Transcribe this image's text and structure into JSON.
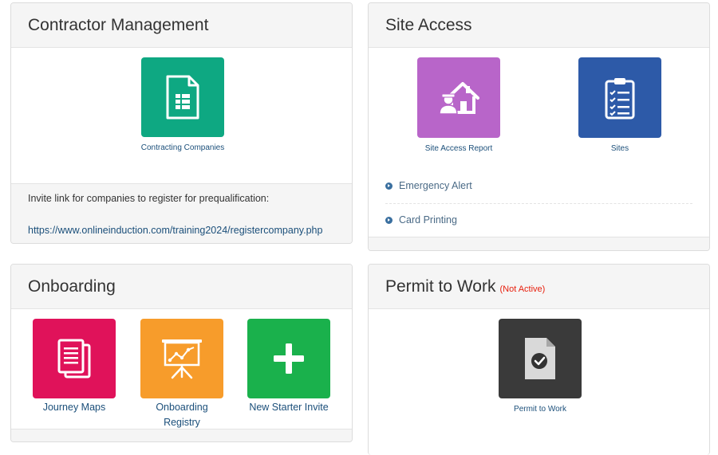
{
  "contractor": {
    "title": "Contractor Management",
    "tile": {
      "label": "Contracting Companies",
      "color": "#0ea882",
      "icon": "spreadsheet-document-icon"
    },
    "invite_text": "Invite link for companies to register for prequalification:",
    "invite_link": "https://www.onlineinduction.com/training2024/registercompany.php"
  },
  "site_access": {
    "title": "Site Access",
    "tiles": [
      {
        "label": "Site Access Report",
        "color": "#b865c9",
        "icon": "house-person-icon"
      },
      {
        "label": "Sites",
        "color": "#2d5aa8",
        "icon": "clipboard-checklist-icon"
      }
    ],
    "links": [
      "Emergency Alert",
      "Card Printing"
    ]
  },
  "onboarding": {
    "title": "Onboarding",
    "tiles": [
      {
        "label": "Journey Maps",
        "color": "#e0125a",
        "icon": "documents-stack-icon"
      },
      {
        "label_line1": "Onboarding",
        "label_line2": "Registry",
        "color": "#f79c2b",
        "icon": "presentation-chart-icon"
      },
      {
        "label": "New Starter Invite",
        "color": "#1ab14c",
        "icon": "plus-icon"
      }
    ]
  },
  "permit": {
    "title": "Permit to Work",
    "status": "(Not Active)",
    "status_color": "#e8200e",
    "tile": {
      "label": "Permit to Work",
      "color": "#3a3a3a",
      "icon": "document-check-icon"
    }
  }
}
